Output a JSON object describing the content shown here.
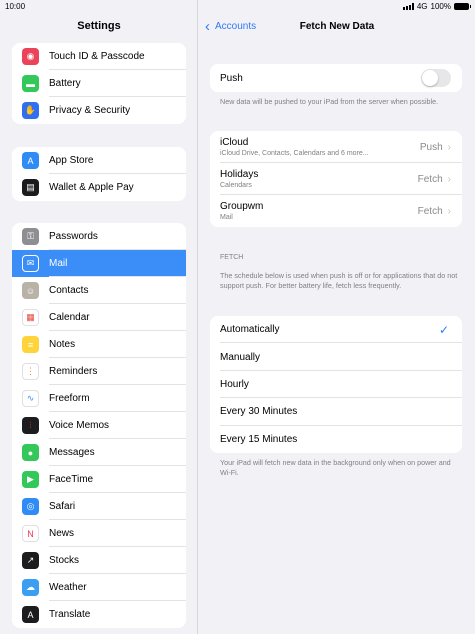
{
  "status": {
    "time": "10:00",
    "network": "4G",
    "battery": "100%"
  },
  "left": {
    "title": "Settings",
    "groups": [
      [
        {
          "label": "Touch ID & Passcode",
          "icon": "fingerprint-icon",
          "color": "#eb445a",
          "glyph": "◉"
        },
        {
          "label": "Battery",
          "icon": "battery-icon",
          "color": "#34c759",
          "glyph": "▬"
        },
        {
          "label": "Privacy & Security",
          "icon": "hand-icon",
          "color": "#2f6ff0",
          "glyph": "✋"
        }
      ],
      [
        {
          "label": "App Store",
          "icon": "app-store-icon",
          "color": "#2f8cf5",
          "glyph": "A"
        },
        {
          "label": "Wallet & Apple Pay",
          "icon": "wallet-icon",
          "color": "#1c1c1e",
          "glyph": "▤"
        }
      ],
      [
        {
          "label": "Passwords",
          "icon": "key-icon",
          "color": "#8e8e93",
          "glyph": "⚿"
        },
        {
          "label": "Mail",
          "icon": "mail-icon",
          "color": "#3b8df7",
          "glyph": "✉",
          "selected": true
        },
        {
          "label": "Contacts",
          "icon": "contacts-icon",
          "color": "#b9b2a6",
          "glyph": "☺"
        },
        {
          "label": "Calendar",
          "icon": "calendar-icon",
          "color": "#ffffff",
          "glyph": "▦",
          "glyph_color": "#e5483d"
        },
        {
          "label": "Notes",
          "icon": "notes-icon",
          "color": "#ffd43b",
          "glyph": "≡"
        },
        {
          "label": "Reminders",
          "icon": "reminders-icon",
          "color": "#ffffff",
          "glyph": "⋮",
          "glyph_color": "#ff7a2e"
        },
        {
          "label": "Freeform",
          "icon": "freeform-icon",
          "color": "#ffffff",
          "glyph": "∿",
          "glyph_color": "#3b8df7"
        },
        {
          "label": "Voice Memos",
          "icon": "voice-memos-icon",
          "color": "#1c1c1e",
          "glyph": "⦙",
          "glyph_color": "#ff453a"
        },
        {
          "label": "Messages",
          "icon": "messages-icon",
          "color": "#34c759",
          "glyph": "●"
        },
        {
          "label": "FaceTime",
          "icon": "facetime-icon",
          "color": "#34c759",
          "glyph": "▶"
        },
        {
          "label": "Safari",
          "icon": "safari-icon",
          "color": "#2f8cf5",
          "glyph": "◎"
        },
        {
          "label": "News",
          "icon": "news-icon",
          "color": "#ffffff",
          "glyph": "N",
          "glyph_color": "#f5334f"
        },
        {
          "label": "Stocks",
          "icon": "stocks-icon",
          "color": "#1c1c1e",
          "glyph": "↗"
        },
        {
          "label": "Weather",
          "icon": "weather-icon",
          "color": "#3b9ef0",
          "glyph": "☁"
        },
        {
          "label": "Translate",
          "icon": "translate-icon",
          "color": "#1c1c1e",
          "glyph": "A"
        }
      ]
    ]
  },
  "right": {
    "back_label": "Accounts",
    "title": "Fetch New Data",
    "push": {
      "label": "Push",
      "enabled": false,
      "footnote": "New data will be pushed to your iPad from the server when possible."
    },
    "accounts": [
      {
        "name": "iCloud",
        "detail": "iCloud Drive, Contacts, Calendars and 6 more...",
        "value": "Push"
      },
      {
        "name": "Holidays",
        "detail": "Calendars",
        "value": "Fetch"
      },
      {
        "name": "Groupwm",
        "detail": "Mail",
        "value": "Fetch"
      }
    ],
    "fetch_header": "FETCH",
    "fetch_footnote": "The schedule below is used when push is off or for applications that do not support push. For better battery life, fetch less frequently.",
    "schedule": [
      {
        "label": "Automatically",
        "selected": true
      },
      {
        "label": "Manually",
        "selected": false
      },
      {
        "label": "Hourly",
        "selected": false
      },
      {
        "label": "Every 30 Minutes",
        "selected": false
      },
      {
        "label": "Every 15 Minutes",
        "selected": false
      }
    ],
    "bottom_footnote": "Your iPad will fetch new data in the background only when on power and Wi-Fi."
  }
}
